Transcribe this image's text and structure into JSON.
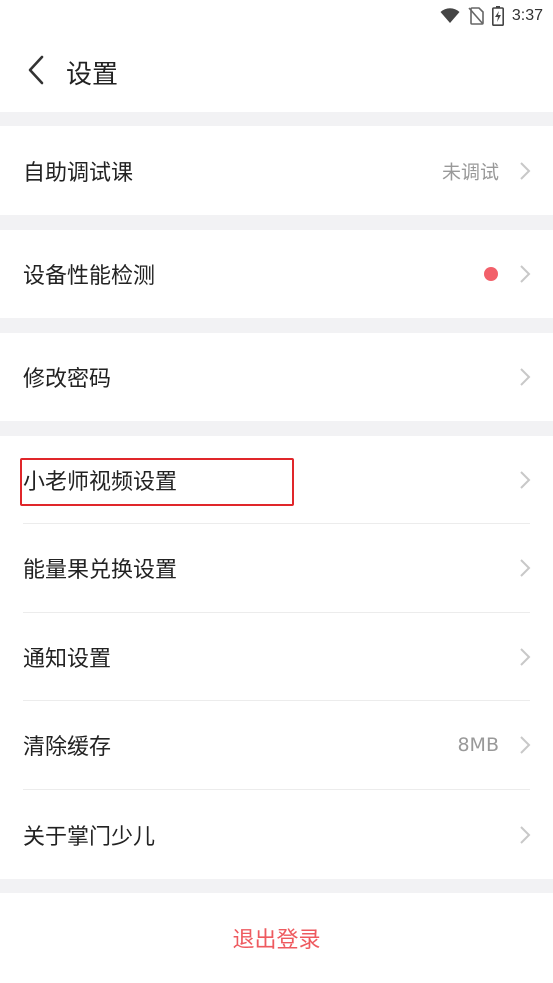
{
  "status_bar": {
    "time": "3:37",
    "icons": [
      "wifi-icon",
      "no-sim-icon",
      "battery-charging-icon"
    ]
  },
  "header": {
    "title": "设置",
    "back_icon": "chevron-left-icon"
  },
  "groups": [
    {
      "items": [
        {
          "label": "自助调试课",
          "value": "未调试"
        }
      ]
    },
    {
      "items": [
        {
          "label": "设备性能检测",
          "badge": "red-dot"
        }
      ]
    },
    {
      "items": [
        {
          "label": "修改密码"
        }
      ]
    },
    {
      "items": [
        {
          "label": "小老师视频设置",
          "highlighted": true
        },
        {
          "label": "能量果兑换设置"
        },
        {
          "label": "通知设置"
        },
        {
          "label": "清除缓存",
          "value": "8MB"
        },
        {
          "label": "关于掌门少儿"
        }
      ]
    }
  ],
  "logout": {
    "label": "退出登录"
  },
  "colors": {
    "accent_red": "#ee5a5f",
    "badge_red": "#f2606a",
    "highlight_red": "#e0262a",
    "section_gap": "#f2f2f4",
    "secondary_text": "#999999"
  }
}
